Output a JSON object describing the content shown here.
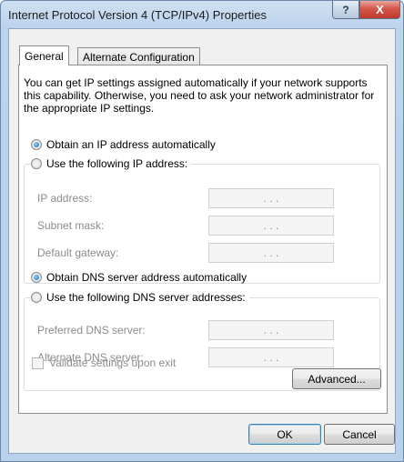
{
  "window": {
    "title": "Internet Protocol Version 4 (TCP/IPv4) Properties"
  },
  "titlebar": {
    "help_glyph": "?",
    "close_glyph": "X"
  },
  "tabs": [
    {
      "label": "General",
      "selected": true
    },
    {
      "label": "Alternate Configuration",
      "selected": false
    }
  ],
  "intro": "You can get IP settings assigned automatically if your network supports this capability. Otherwise, you need to ask your network administrator for the appropriate IP settings.",
  "ip": {
    "auto_label": "Obtain an IP address automatically",
    "auto_selected": true,
    "manual_label": "Use the following IP address:",
    "manual_selected": false,
    "fields": [
      {
        "label": "IP address:",
        "value": ". . ."
      },
      {
        "label": "Subnet mask:",
        "value": ". . ."
      },
      {
        "label": "Default gateway:",
        "value": ". . ."
      }
    ]
  },
  "dns": {
    "auto_label": "Obtain DNS server address automatically",
    "auto_selected": true,
    "manual_label": "Use the following DNS server addresses:",
    "manual_selected": false,
    "fields": [
      {
        "label": "Preferred DNS server:",
        "value": ". . ."
      },
      {
        "label": "Alternate DNS server:",
        "value": ". . ."
      }
    ]
  },
  "validate": {
    "label": "Validate settings upon exit",
    "checked": false
  },
  "buttons": {
    "advanced": "Advanced...",
    "ok": "OK",
    "cancel": "Cancel"
  }
}
